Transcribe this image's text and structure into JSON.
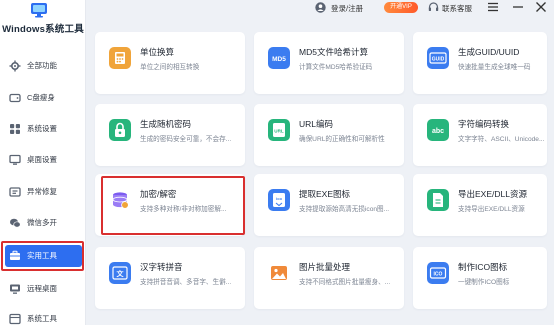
{
  "app": {
    "title": "Windows系统工具"
  },
  "sidebar": {
    "items": [
      {
        "label": "全部功能",
        "icon": "gear-icon"
      },
      {
        "label": "C盘瘦身",
        "icon": "disk-icon"
      },
      {
        "label": "系统设置",
        "icon": "grid-icon"
      },
      {
        "label": "桌面设置",
        "icon": "monitor-icon"
      },
      {
        "label": "异常修复",
        "icon": "wrench-icon"
      },
      {
        "label": "微信多开",
        "icon": "wechat-icon"
      },
      {
        "label": "实用工具",
        "icon": "toolbox-icon",
        "active": true
      },
      {
        "label": "远程桌面",
        "icon": "remote-icon"
      },
      {
        "label": "系统工具",
        "icon": "tools-icon"
      }
    ]
  },
  "topbar": {
    "login_label": "登录/注册",
    "vip_label": "开通VIP",
    "support_label": "联系客服"
  },
  "cards": [
    {
      "title": "单位换算",
      "desc": "单位之间的相互转换",
      "icon": "unit-convert-icon",
      "color": "#f0a43a"
    },
    {
      "title": "MD5文件哈希计算",
      "desc": "计算文件MD5哈希验证码",
      "icon": "md5-icon",
      "color": "#3b7cf0"
    },
    {
      "title": "生成GUID/UUID",
      "desc": "快速批量生成全球唯一码",
      "icon": "guid-icon",
      "color": "#3b7cf0"
    },
    {
      "title": "生成随机密码",
      "desc": "生成的密码安全可靠，不会存...",
      "icon": "lock-icon",
      "color": "#27b57c"
    },
    {
      "title": "URL编码",
      "desc": "确保URL的正确性和可解析性",
      "icon": "url-icon",
      "color": "#27b57c"
    },
    {
      "title": "字符编码转换",
      "desc": "文字字符、ASCII、Unicode...",
      "icon": "abc-icon",
      "color": "#27b57c"
    },
    {
      "title": "加密/解密",
      "desc": "支持多种对称/非对称加密解...",
      "icon": "encrypt-icon",
      "color": "#7c5cf0"
    },
    {
      "title": "提取EXE图标",
      "desc": "支持提取源始高清无损icon图...",
      "icon": "exe-icon",
      "color": "#3b7cf0"
    },
    {
      "title": "导出EXE/DLL资源",
      "desc": "支持导出EXE/DLL资源",
      "icon": "export-icon",
      "color": "#27b57c"
    },
    {
      "title": "汉字转拼音",
      "desc": "支持拼音音调、多音字、生僻...",
      "icon": "pinyin-icon",
      "color": "#3b7cf0"
    },
    {
      "title": "图片批量处理",
      "desc": "支持不同格式图片批量瘦身、...",
      "icon": "image-batch-icon",
      "color": "#f08a3a"
    },
    {
      "title": "制作ICO图标",
      "desc": "一键制作ICO图标",
      "icon": "ico-icon",
      "color": "#3b7cf0"
    }
  ]
}
